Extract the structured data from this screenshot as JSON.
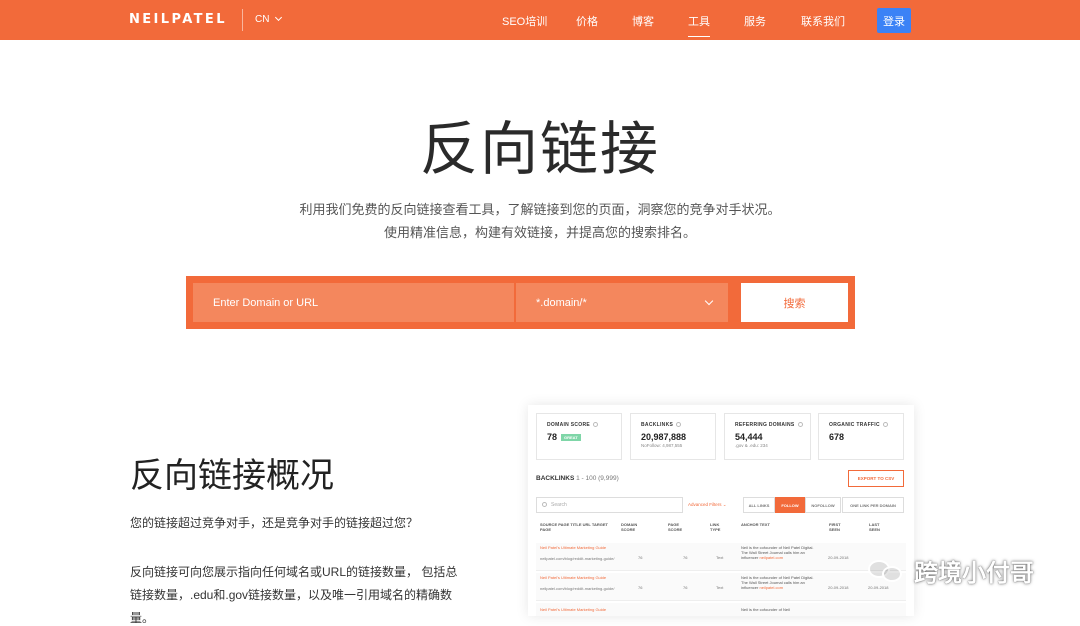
{
  "nav": {
    "logo": "NEILPATEL",
    "lang": "CN",
    "items": [
      "SEO培训",
      "价格",
      "博客",
      "工具",
      "服务",
      "联系我们"
    ],
    "active": "工具",
    "login": "登录"
  },
  "hero": {
    "title": "反向链接",
    "subtitle_line1": "利用我们免费的反向链接查看工具，了解链接到您的页面，洞察您的竞争对手状况。",
    "subtitle_line2": "使用精准信息，构建有效链接，并提高您的搜索排名。"
  },
  "search": {
    "input_placeholder": "Enter Domain or URL",
    "select_value": "*.domain/*",
    "button": "搜索"
  },
  "overview": {
    "title": "反向链接概况",
    "p1": "您的链接超过竞争对手，还是竞争对手的链接超过您？",
    "p2_line1": "反向链接可向您展示指向任何域名或URL的链接数量， 包括总",
    "p2_line2": "链接数量，.edu和.gov链接数量，以及唯一引用域名的精确数",
    "p2_line3": "量。"
  },
  "preview": {
    "stats": [
      {
        "label": "DOMAIN SCORE",
        "value": "78",
        "badge": "GREAT",
        "note": ""
      },
      {
        "label": "BACKLINKS",
        "value": "20,987,888",
        "badge": "",
        "note": "NoFollow: 4,987,555"
      },
      {
        "label": "REFERRING DOMAINS",
        "value": "54,444",
        "badge": "",
        "note": ".gov & .edu: 234"
      },
      {
        "label": "ORGANIC TRAFFIC",
        "value": "678",
        "badge": "",
        "note": ""
      }
    ],
    "backlinks_title": "BACKLINKS",
    "backlinks_range": "1 - 100 (9,999)",
    "export": "EXPORT TO CSV",
    "search_placeholder": "Search",
    "advanced": "Advanced Filters ⌄",
    "filter_tabs": [
      "ALL LINKS",
      "FOLLOW",
      "NOFOLLOW",
      "ONE LINK PER DOMAIN"
    ],
    "active_filter": "FOLLOW",
    "columns": [
      "SOURCE PAGE TITLE URL TARGET PAGE",
      "DOMAIN SCORE",
      "PAGE SCORE",
      "LINK TYPE",
      "ANCHOR TEXT",
      "FIRST SEEN",
      "LAST SEEN"
    ],
    "rows": [
      {
        "title": "Neil Patel's Ultimate Marketing Guide",
        "url": "neilpatel.com/blog/reddit-marketing-guide/",
        "domain_score": "76",
        "page_score": "76",
        "type": "Text",
        "anchor": "Neil is the cofounder of Neil Patel Digital. The Wall Street Journal calls him an influencer",
        "anchor_link": "neilpatel.com",
        "first_seen": "20-09-2018",
        "last_seen": ""
      },
      {
        "title": "Neil Patel's Ultimate Marketing Guide",
        "url": "neilpatel.com/blog/reddit-marketing-guide/",
        "domain_score": "76",
        "page_score": "76",
        "type": "Text",
        "anchor": "Neil is the cofounder of Neil Patel Digital. The Wall Street Journal calls him an influencer",
        "anchor_link": "neilpatel.com",
        "first_seen": "20-09-2018",
        "last_seen": "20-09-2018"
      },
      {
        "title": "Neil Patel's Ultimate Marketing Guide",
        "url": "",
        "domain_score": "",
        "page_score": "",
        "type": "",
        "anchor": "Neil is the cofounder of Neil",
        "anchor_link": "",
        "first_seen": "",
        "last_seen": ""
      }
    ]
  },
  "watermark": "跨境小付哥",
  "colors": {
    "brand": "#f26a3a",
    "login": "#3b82f6",
    "badge": "#7fd6a8"
  }
}
